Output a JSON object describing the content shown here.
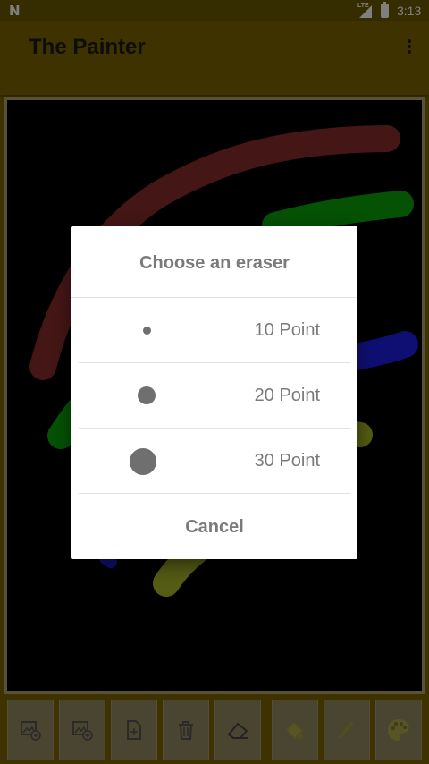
{
  "status_bar": {
    "network_label": "LTE",
    "time": "3:13"
  },
  "app_bar": {
    "title": "The Painter"
  },
  "dialog": {
    "title": "Choose an eraser",
    "options": [
      {
        "label": "10 Point"
      },
      {
        "label": "20 Point"
      },
      {
        "label": "30 Point"
      }
    ],
    "cancel_label": "Cancel"
  },
  "toolbar": {
    "tools": [
      {
        "icon": "open-image-icon"
      },
      {
        "icon": "add-image-icon"
      },
      {
        "icon": "new-file-icon"
      },
      {
        "icon": "trash-icon"
      },
      {
        "icon": "eraser-icon"
      },
      {
        "icon": "fill-icon"
      },
      {
        "icon": "brush-icon"
      },
      {
        "icon": "palette-icon"
      }
    ]
  },
  "colors": {
    "app_bar": "#7a6500",
    "stroke_red": "#8b2c2c",
    "stroke_green": "#0aa50a",
    "stroke_blue": "#1e1ee6",
    "stroke_yellow": "#a8b82a"
  }
}
